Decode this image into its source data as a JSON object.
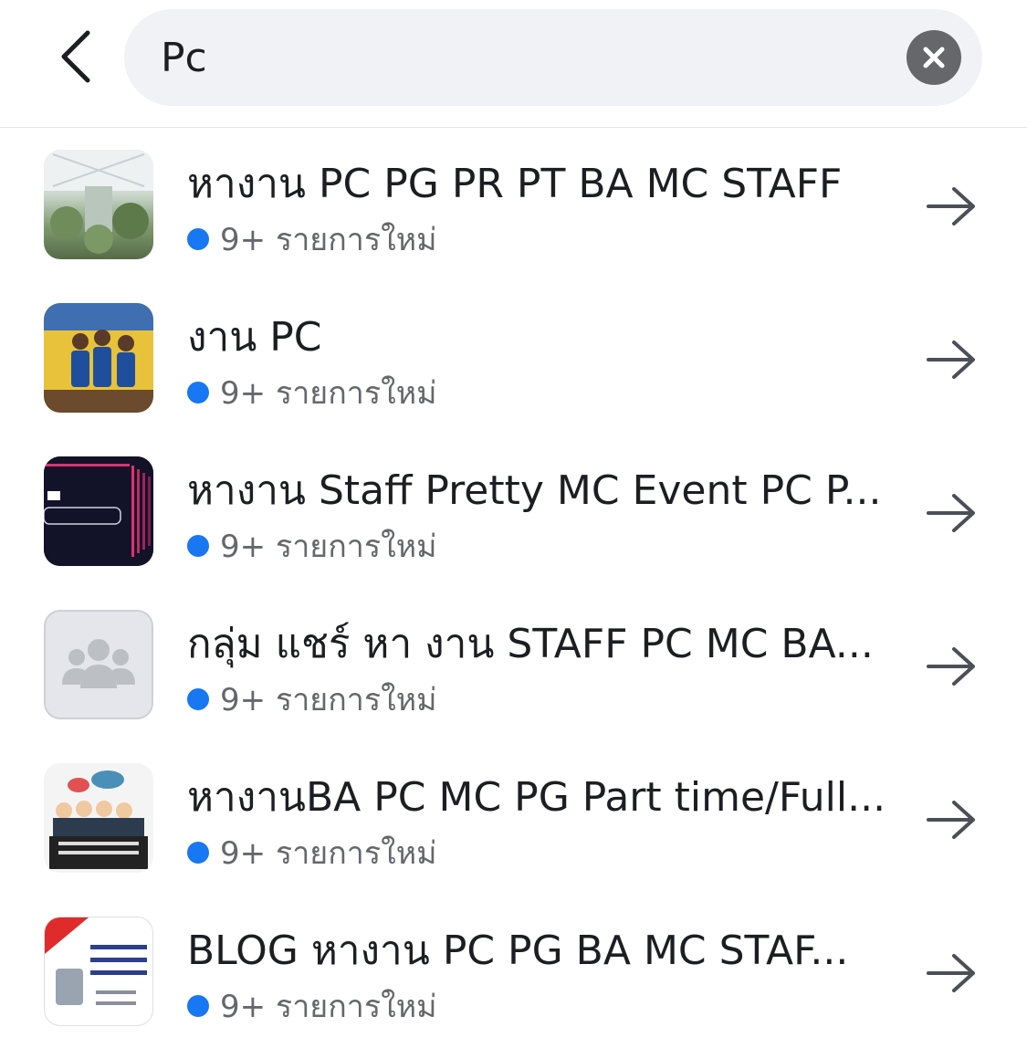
{
  "search": {
    "query": "Pc"
  },
  "results": [
    {
      "name": "หางาน PC PG PR PT BA MC STAFF",
      "meta": "9+ รายการใหม่"
    },
    {
      "name": "งาน PC",
      "meta": "9+ รายการใหม่"
    },
    {
      "name": "หางาน Staff Pretty MC Event PC P...",
      "meta": "9+ รายการใหม่"
    },
    {
      "name": "กลุ่ม แชร์ หา งาน STAFF PC MC BA...",
      "meta": "9+ รายการใหม่"
    },
    {
      "name": "หางานBA PC MC PG Part time/Full...",
      "meta": "9+ รายการใหม่"
    },
    {
      "name": "BLOG หางาน PC PG BA MC STAF...",
      "meta": "9+ รายการใหม่"
    }
  ],
  "icons": {
    "back": "chevron-left-icon",
    "clear": "close-circle-icon",
    "open": "arrow-right-icon",
    "unread": "blue-dot-icon"
  },
  "colors": {
    "accent": "#1877f2",
    "search_bg": "#f0f2f5",
    "secondary_text": "#65676b",
    "clear_button": "#65676b"
  }
}
